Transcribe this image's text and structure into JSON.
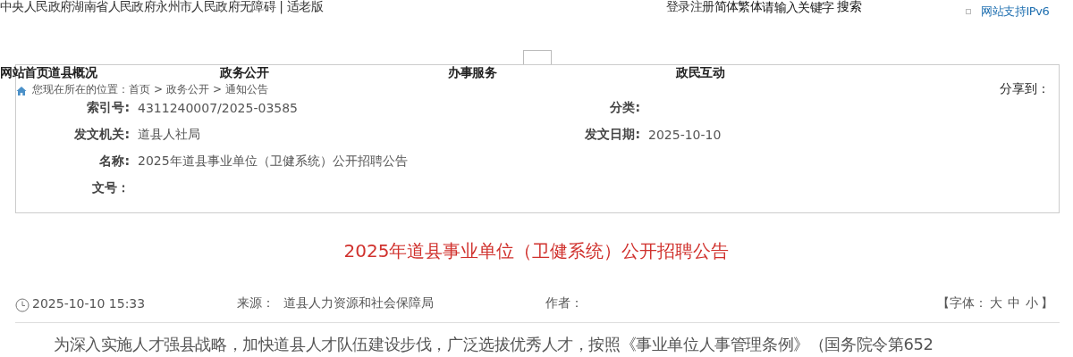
{
  "top_links": [
    "中央人民政府",
    "湖南省人民政府",
    "永州市人民政府",
    "无障碍"
  ],
  "top_sep": "|",
  "elder_link": "适老版",
  "user_links": [
    "登录",
    "注册"
  ],
  "lang_links": [
    "简体",
    "繁体"
  ],
  "search": {
    "placeholder": "请输入关键字",
    "button": "搜索"
  },
  "ipv6": "网站支持IPv6",
  "nav": [
    {
      "label": "网站首页"
    },
    {
      "label": "道县概况"
    },
    {
      "label": "政务公开"
    },
    {
      "label": "办事服务"
    },
    {
      "label": "政民互动"
    }
  ],
  "breadcrumb": {
    "prefix": "您现在所在的位置：",
    "items": [
      "首页",
      "政务公开",
      "通知公告"
    ],
    "separator": ">"
  },
  "share_label": "分享到：",
  "meta": [
    {
      "label": "索引号:",
      "value": "4311240007/2025-03585",
      "label2": "分类:"
    },
    {
      "label": "发文机关:",
      "value": "道县人社局",
      "label2": "发文日期:",
      "value2": "2025-10-10"
    },
    {
      "label": "名称:",
      "value": "2025年道县事业单位（卫健系统）公开招聘公告"
    },
    {
      "label": "文号："
    }
  ],
  "article": {
    "title": "2025年道县事业单位（卫健系统）公开招聘公告",
    "date": "2025-10-10 15:33",
    "source_label": "来源：",
    "source": "道县人力资源和社会保障局",
    "author_label": "作者：",
    "font_open": "【字体：",
    "font_sizes": [
      "大",
      "中",
      "小"
    ],
    "font_close": "】",
    "paragraph": "为深入实施人才强县战略，加快道县人才队伍建设步伐，广泛选拔优秀人才，按照《事业单位人事管理条例》（国务院令第652"
  }
}
